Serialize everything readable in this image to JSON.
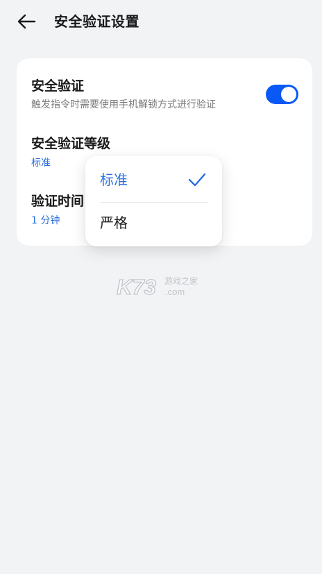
{
  "header": {
    "title": "安全验证设置",
    "back_icon": "arrow-left-icon"
  },
  "security": {
    "title": "安全验证",
    "subtitle": "触发指令时需要使用手机解锁方式进行验证",
    "toggle_on": true,
    "accent_color": "#0a59f7"
  },
  "level": {
    "title": "安全验证等级",
    "value": "标准"
  },
  "verify_time": {
    "title": "验证时间",
    "value": "1 分钟"
  },
  "dropdown": {
    "options": [
      "标准",
      "严格"
    ],
    "selected": "标准",
    "selected_color": "#2a6fe0"
  },
  "watermark": {
    "text_main": "K73",
    "text_cn": "游戏之家",
    "text_domain": ".com"
  }
}
